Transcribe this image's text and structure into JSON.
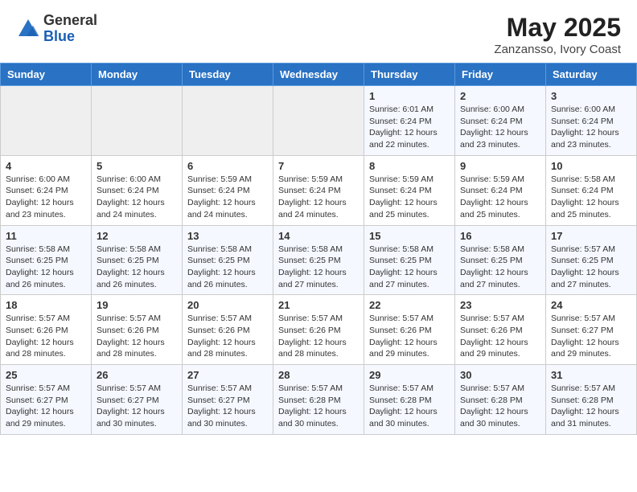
{
  "logo": {
    "general": "General",
    "blue": "Blue"
  },
  "title": {
    "month_year": "May 2025",
    "location": "Zanzansso, Ivory Coast"
  },
  "weekdays": [
    "Sunday",
    "Monday",
    "Tuesday",
    "Wednesday",
    "Thursday",
    "Friday",
    "Saturday"
  ],
  "weeks": [
    [
      {
        "day": "",
        "info": ""
      },
      {
        "day": "",
        "info": ""
      },
      {
        "day": "",
        "info": ""
      },
      {
        "day": "",
        "info": ""
      },
      {
        "day": "1",
        "info": "Sunrise: 6:01 AM\nSunset: 6:24 PM\nDaylight: 12 hours and 22 minutes."
      },
      {
        "day": "2",
        "info": "Sunrise: 6:00 AM\nSunset: 6:24 PM\nDaylight: 12 hours and 23 minutes."
      },
      {
        "day": "3",
        "info": "Sunrise: 6:00 AM\nSunset: 6:24 PM\nDaylight: 12 hours and 23 minutes."
      }
    ],
    [
      {
        "day": "4",
        "info": "Sunrise: 6:00 AM\nSunset: 6:24 PM\nDaylight: 12 hours and 23 minutes."
      },
      {
        "day": "5",
        "info": "Sunrise: 6:00 AM\nSunset: 6:24 PM\nDaylight: 12 hours and 24 minutes."
      },
      {
        "day": "6",
        "info": "Sunrise: 5:59 AM\nSunset: 6:24 PM\nDaylight: 12 hours and 24 minutes."
      },
      {
        "day": "7",
        "info": "Sunrise: 5:59 AM\nSunset: 6:24 PM\nDaylight: 12 hours and 24 minutes."
      },
      {
        "day": "8",
        "info": "Sunrise: 5:59 AM\nSunset: 6:24 PM\nDaylight: 12 hours and 25 minutes."
      },
      {
        "day": "9",
        "info": "Sunrise: 5:59 AM\nSunset: 6:24 PM\nDaylight: 12 hours and 25 minutes."
      },
      {
        "day": "10",
        "info": "Sunrise: 5:58 AM\nSunset: 6:24 PM\nDaylight: 12 hours and 25 minutes."
      }
    ],
    [
      {
        "day": "11",
        "info": "Sunrise: 5:58 AM\nSunset: 6:25 PM\nDaylight: 12 hours and 26 minutes."
      },
      {
        "day": "12",
        "info": "Sunrise: 5:58 AM\nSunset: 6:25 PM\nDaylight: 12 hours and 26 minutes."
      },
      {
        "day": "13",
        "info": "Sunrise: 5:58 AM\nSunset: 6:25 PM\nDaylight: 12 hours and 26 minutes."
      },
      {
        "day": "14",
        "info": "Sunrise: 5:58 AM\nSunset: 6:25 PM\nDaylight: 12 hours and 27 minutes."
      },
      {
        "day": "15",
        "info": "Sunrise: 5:58 AM\nSunset: 6:25 PM\nDaylight: 12 hours and 27 minutes."
      },
      {
        "day": "16",
        "info": "Sunrise: 5:58 AM\nSunset: 6:25 PM\nDaylight: 12 hours and 27 minutes."
      },
      {
        "day": "17",
        "info": "Sunrise: 5:57 AM\nSunset: 6:25 PM\nDaylight: 12 hours and 27 minutes."
      }
    ],
    [
      {
        "day": "18",
        "info": "Sunrise: 5:57 AM\nSunset: 6:26 PM\nDaylight: 12 hours and 28 minutes."
      },
      {
        "day": "19",
        "info": "Sunrise: 5:57 AM\nSunset: 6:26 PM\nDaylight: 12 hours and 28 minutes."
      },
      {
        "day": "20",
        "info": "Sunrise: 5:57 AM\nSunset: 6:26 PM\nDaylight: 12 hours and 28 minutes."
      },
      {
        "day": "21",
        "info": "Sunrise: 5:57 AM\nSunset: 6:26 PM\nDaylight: 12 hours and 28 minutes."
      },
      {
        "day": "22",
        "info": "Sunrise: 5:57 AM\nSunset: 6:26 PM\nDaylight: 12 hours and 29 minutes."
      },
      {
        "day": "23",
        "info": "Sunrise: 5:57 AM\nSunset: 6:26 PM\nDaylight: 12 hours and 29 minutes."
      },
      {
        "day": "24",
        "info": "Sunrise: 5:57 AM\nSunset: 6:27 PM\nDaylight: 12 hours and 29 minutes."
      }
    ],
    [
      {
        "day": "25",
        "info": "Sunrise: 5:57 AM\nSunset: 6:27 PM\nDaylight: 12 hours and 29 minutes."
      },
      {
        "day": "26",
        "info": "Sunrise: 5:57 AM\nSunset: 6:27 PM\nDaylight: 12 hours and 30 minutes."
      },
      {
        "day": "27",
        "info": "Sunrise: 5:57 AM\nSunset: 6:27 PM\nDaylight: 12 hours and 30 minutes."
      },
      {
        "day": "28",
        "info": "Sunrise: 5:57 AM\nSunset: 6:28 PM\nDaylight: 12 hours and 30 minutes."
      },
      {
        "day": "29",
        "info": "Sunrise: 5:57 AM\nSunset: 6:28 PM\nDaylight: 12 hours and 30 minutes."
      },
      {
        "day": "30",
        "info": "Sunrise: 5:57 AM\nSunset: 6:28 PM\nDaylight: 12 hours and 30 minutes."
      },
      {
        "day": "31",
        "info": "Sunrise: 5:57 AM\nSunset: 6:28 PM\nDaylight: 12 hours and 31 minutes."
      }
    ]
  ]
}
